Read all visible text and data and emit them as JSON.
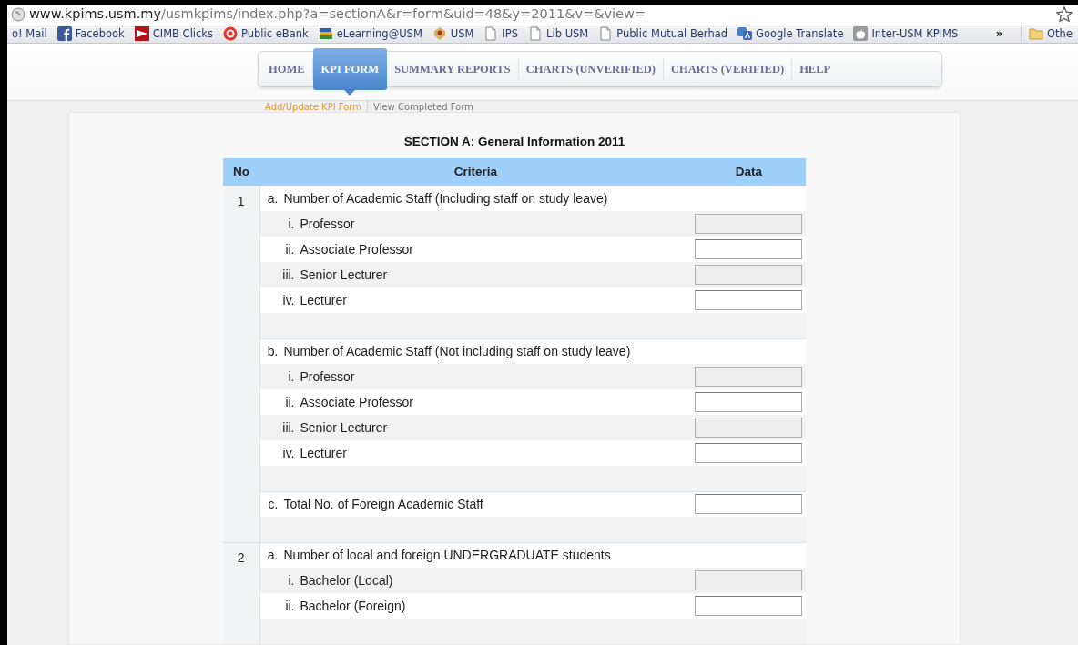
{
  "browser": {
    "url_host": "www.kpims.usm.my",
    "url_path": "/usmkpims/index.php?a=sectionA&r=form&uid=48&y=2011&v=&view=",
    "bookmarks": [
      {
        "kind": "none",
        "label": "o! Mail"
      },
      {
        "kind": "facebook",
        "label": "Facebook"
      },
      {
        "kind": "flag",
        "label": "CIMB Clicks"
      },
      {
        "kind": "ring",
        "label": "Public eBank"
      },
      {
        "kind": "books",
        "label": "eLearning@USM"
      },
      {
        "kind": "crest",
        "label": "USM"
      },
      {
        "kind": "page",
        "label": "IPS"
      },
      {
        "kind": "page",
        "label": "Lib USM"
      },
      {
        "kind": "page",
        "label": "Public Mutual Berhad"
      },
      {
        "kind": "translate",
        "label": "Google Translate"
      },
      {
        "kind": "apple",
        "label": "Inter-USM KPIMS"
      }
    ],
    "overflow": "»",
    "other": "Othe"
  },
  "nav": {
    "tabs": [
      {
        "label": "HOME",
        "selected": false
      },
      {
        "label": "KPI FORM",
        "selected": true
      },
      {
        "label": "SUMMARY REPORTS",
        "selected": false
      },
      {
        "label": "CHARTS (UNVERIFIED)",
        "selected": false
      },
      {
        "label": "CHARTS (VERIFIED)",
        "selected": false
      },
      {
        "label": "HELP",
        "selected": false
      }
    ],
    "sublinks": [
      {
        "label": "Add/Update KPI Form",
        "selected": true
      },
      {
        "label": "View Completed Form",
        "selected": false
      }
    ]
  },
  "form": {
    "title": "SECTION A: General Information 2011",
    "columns": [
      "No",
      "Criteria",
      "Data"
    ],
    "groups": [
      {
        "no": "1",
        "sections": [
          {
            "marker": "a.",
            "label": "Number of Academic Staff (Including staff on study leave)",
            "items": [
              {
                "marker": "i.",
                "label": "Professor",
                "disabled": true
              },
              {
                "marker": "ii.",
                "label": "Associate Professor",
                "disabled": false
              },
              {
                "marker": "iii.",
                "label": "Senior Lecturer",
                "disabled": true
              },
              {
                "marker": "iv.",
                "label": "Lecturer",
                "disabled": false
              }
            ]
          },
          {
            "marker": "b.",
            "label": "Number of Academic Staff (Not including staff on study leave)",
            "items": [
              {
                "marker": "i.",
                "label": "Professor",
                "disabled": true
              },
              {
                "marker": "ii.",
                "label": "Associate Professor",
                "disabled": false
              },
              {
                "marker": "iii.",
                "label": "Senior Lecturer",
                "disabled": true
              },
              {
                "marker": "iv.",
                "label": "Lecturer",
                "disabled": false
              }
            ]
          },
          {
            "marker": "c.",
            "label": "Total No. of Foreign Academic Staff",
            "field": {
              "disabled": false
            }
          }
        ]
      },
      {
        "no": "2",
        "sections": [
          {
            "marker": "a.",
            "label": "Number of local and foreign UNDERGRADUATE students",
            "items": [
              {
                "marker": "i.",
                "label": "Bachelor (Local)",
                "disabled": true
              },
              {
                "marker": "ii.",
                "label": "Bachelor (Foreign)",
                "disabled": false
              }
            ]
          }
        ]
      }
    ]
  }
}
